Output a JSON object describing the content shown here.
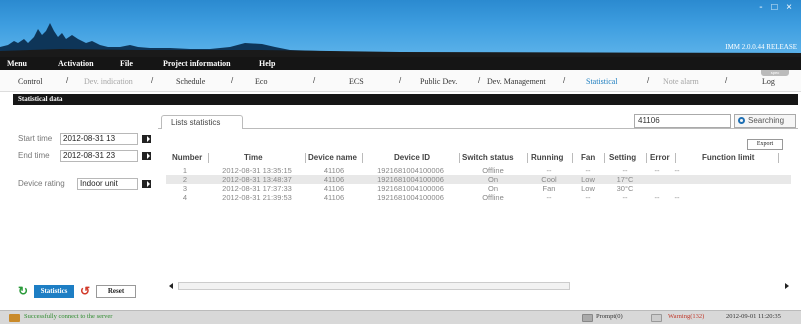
{
  "window": {
    "controls": "- □ ×",
    "release": "IMM 2.0.0.44 RELEASE"
  },
  "menu": {
    "items": [
      "Menu",
      "Activation",
      "File",
      "Project information",
      "Help"
    ]
  },
  "nav": {
    "items": [
      {
        "label": "Control",
        "state": "normal"
      },
      {
        "label": "Dev. indication",
        "state": "disabled"
      },
      {
        "label": "Schedule",
        "state": "normal"
      },
      {
        "label": "Eco",
        "state": "normal"
      },
      {
        "label": "ECS",
        "state": "normal"
      },
      {
        "label": "Public Dev.",
        "state": "normal"
      },
      {
        "label": "Dev. Management",
        "state": "normal"
      },
      {
        "label": "Statistical",
        "state": "active"
      },
      {
        "label": "Note alarm",
        "state": "disabled"
      },
      {
        "label": "Log",
        "state": "normal"
      }
    ],
    "tag": "spec"
  },
  "section_title": "Statistical data",
  "filters": {
    "start_label": "Start time",
    "start_value": "2012-08-31 13",
    "end_label": "End time",
    "end_value": "2012-08-31 23",
    "rating_label": "Device rating",
    "rating_value": "Indoor unit"
  },
  "buttons": {
    "statistics": "Statistics",
    "reset": "Reset",
    "export": "Export",
    "search": "Searching"
  },
  "tab_label": "Lists statistics",
  "search_value": "41106",
  "table": {
    "headers": [
      "Number",
      "Time",
      "Device name",
      "Device ID",
      "Switch status",
      "Running",
      "Fan",
      "Setting",
      "Error",
      "Function limit"
    ],
    "rows": [
      [
        "1",
        "2012-08-31 13:35:15",
        "41106",
        "1921681004100006",
        "Offline",
        "--",
        "--",
        "--",
        "--",
        "--"
      ],
      [
        "2",
        "2012-08-31 13:48:37",
        "41106",
        "1921681004100006",
        "On",
        "Cool",
        "Low",
        "17°C",
        "",
        ""
      ],
      [
        "3",
        "2012-08-31 17:37:33",
        "41106",
        "1921681004100006",
        "On",
        "Fan",
        "Low",
        "30°C",
        "",
        ""
      ],
      [
        "4",
        "2012-08-31 21:39:53",
        "41106",
        "1921681004100006",
        "Offline",
        "--",
        "--",
        "--",
        "--",
        "--"
      ]
    ],
    "selected_row": 1
  },
  "status": {
    "message": "Successfully connect to the server",
    "prompt": "Prompt(0)",
    "warning": "Warning(132)",
    "datetime": "2012-09-01 11:20:35"
  },
  "colors": {
    "accent": "#1d7ec4",
    "warning": "#c0392b",
    "success": "#2e8b2e",
    "banner": "#3e9ee0"
  }
}
